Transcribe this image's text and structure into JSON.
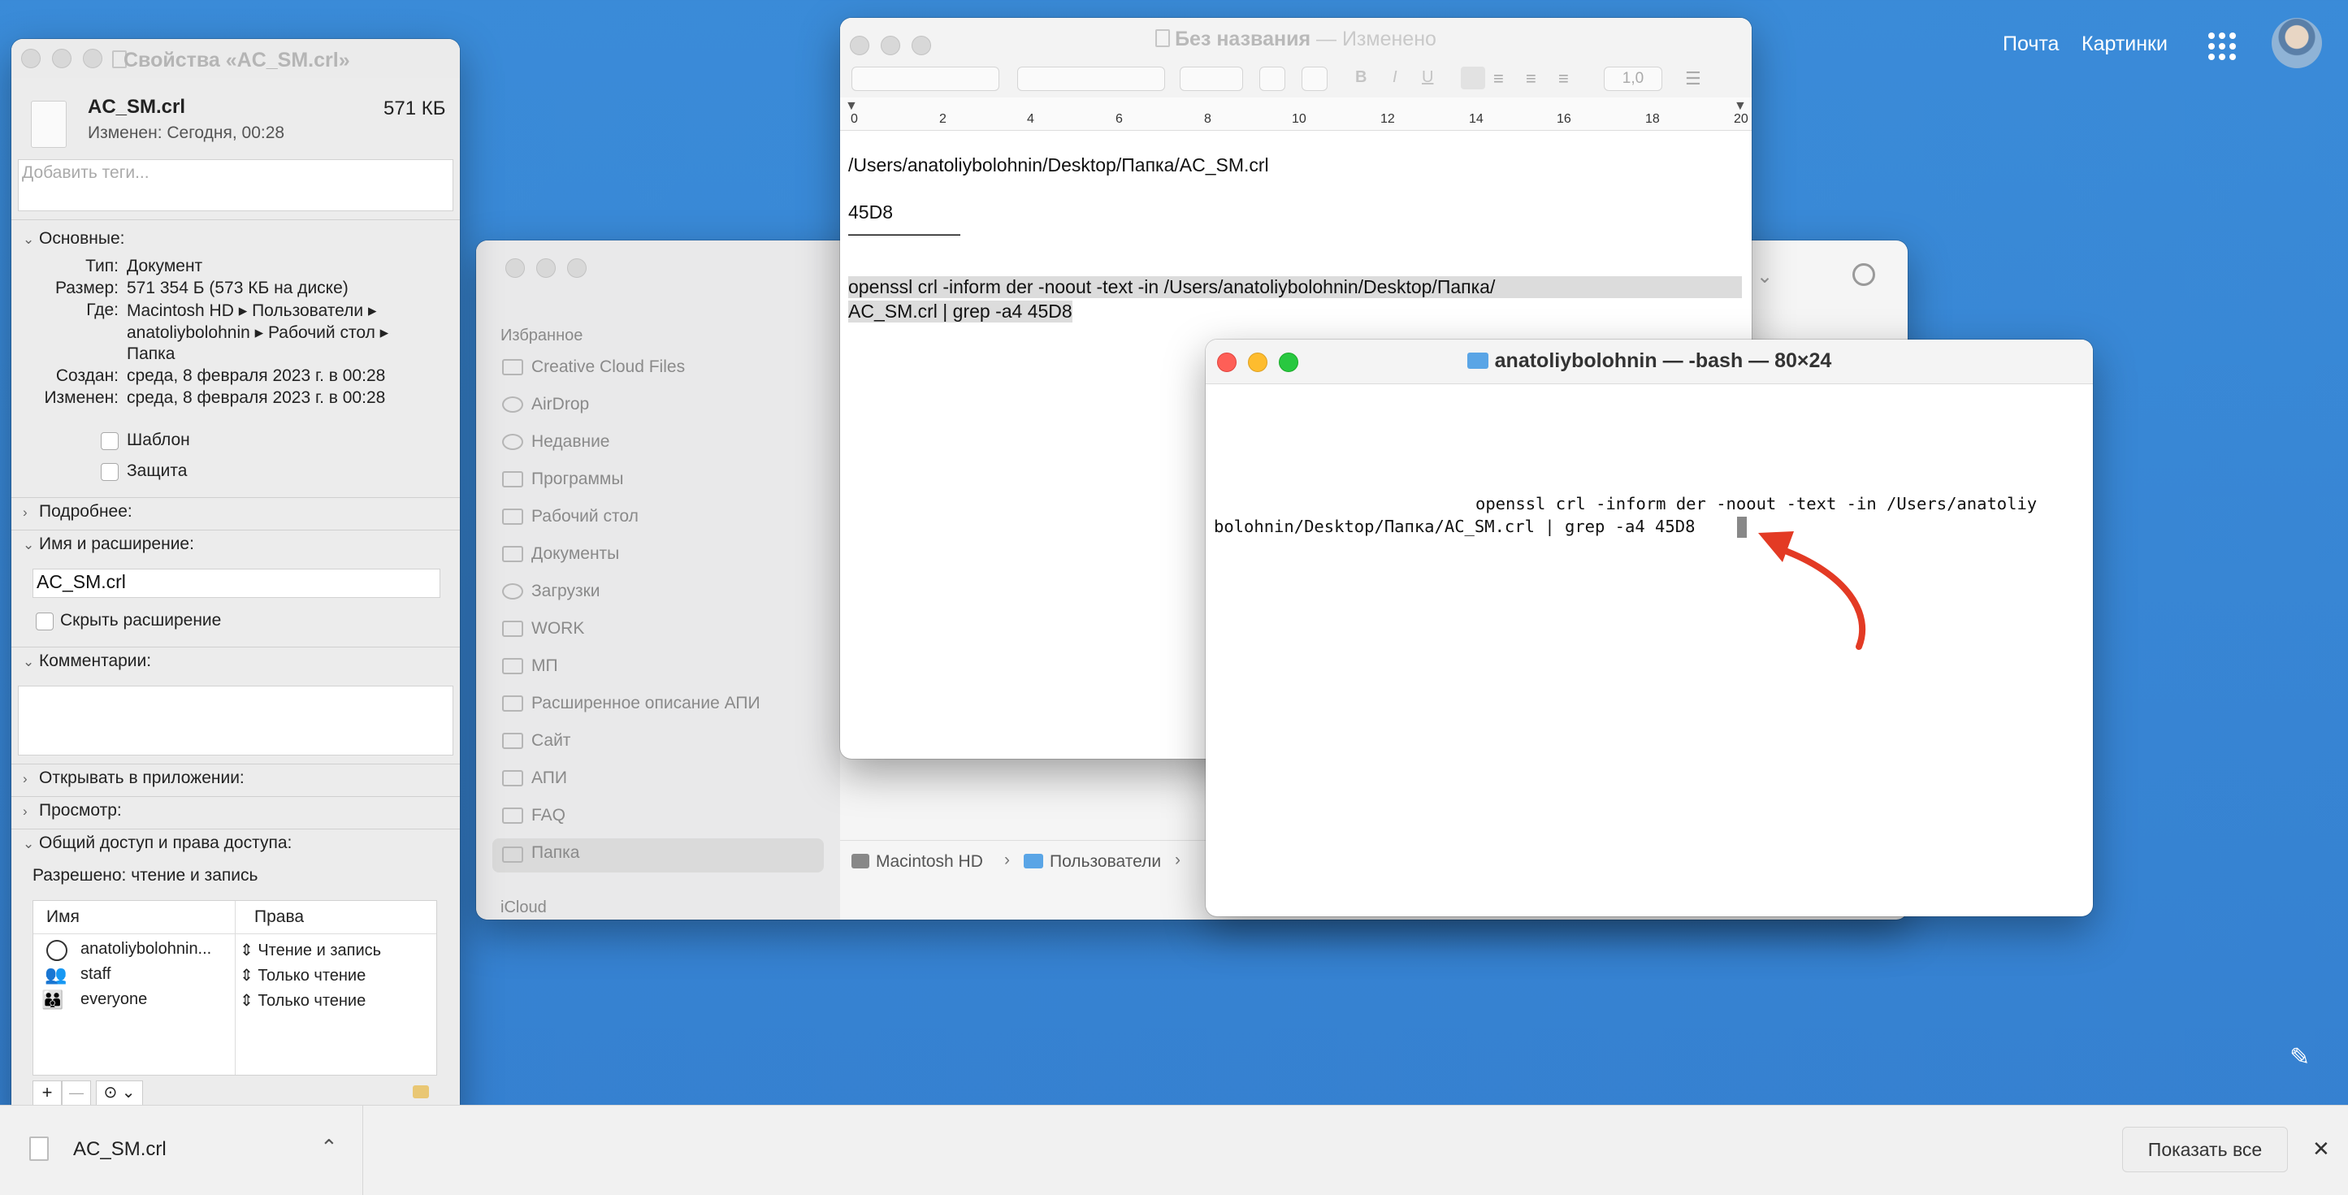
{
  "browser": {
    "mail_link": "Почта",
    "images_link": "Картинки",
    "apps_icon": "grid-icon",
    "avatar_icon": "avatar-icon",
    "edit_icon": "pencil-icon"
  },
  "info_window": {
    "title": "Свойства «AC_SM.crl»",
    "file_name": "AC_SM.crl",
    "file_size": "571 КБ",
    "modified_short": "Изменен: Сегодня, 00:28",
    "tags_placeholder": "Добавить теги...",
    "general": {
      "header": "Основные:",
      "kind_label": "Тип:",
      "kind_value": "Документ",
      "size_label": "Размер:",
      "size_value": "571 354 Б (573 КБ на диске)",
      "where_label": "Где:",
      "where_line1": "Macintosh HD ▸ Пользователи ▸",
      "where_line2": "anatoliybolohnin ▸ Рабочий стол ▸",
      "where_line3": "Папка",
      "created_label": "Создан:",
      "created_value": "среда, 8 февраля 2023 г. в 00:28",
      "modified_label": "Изменен:",
      "modified_value": "среда, 8 февраля 2023 г. в 00:28",
      "template_label": "Шаблон",
      "locked_label": "Защита"
    },
    "more_info": "Подробнее:",
    "name_ext": {
      "header": "Имя и расширение:",
      "value": "AC_SM.crl",
      "hide_ext_label": "Скрыть расширение"
    },
    "comments": "Комментарии:",
    "open_with": "Открывать в приложении:",
    "preview": "Просмотр:",
    "sharing": {
      "header": "Общий доступ и права доступа:",
      "status": "Разрешено: чтение и запись",
      "col_name": "Имя",
      "col_rights": "Права",
      "rows": [
        {
          "name": "anatoliybolohnin...",
          "rights": "Чтение и запись",
          "icon": "user-icon"
        },
        {
          "name": "staff",
          "rights": "Только чтение",
          "icon": "group-icon"
        },
        {
          "name": "everyone",
          "rights": "Только чтение",
          "icon": "everyone-icon"
        }
      ],
      "add": "+",
      "remove": "—",
      "action": "⊙",
      "lock_icon": "lock-icon"
    }
  },
  "textedit": {
    "title": "Без названия",
    "title_suffix": "— Изменено",
    "spacing": "1,0",
    "ruler": [
      "0",
      "2",
      "4",
      "6",
      "8",
      "10",
      "12",
      "14",
      "16",
      "18",
      "20"
    ],
    "lines": [
      "/Users/anatoliybolohnin/Desktop/Папка/AC_SM.crl",
      "45D8",
      "——————",
      "openssl crl -inform der -noout -text -in /Users/anatoliybolohnin/Desktop/Папка/",
      "AC_SM.crl | grep -a4 45D8"
    ]
  },
  "finder": {
    "favorites_header": "Избранное",
    "sidebar": [
      "Creative Cloud Files",
      "AirDrop",
      "Недавние",
      "Программы",
      "Рабочий стол",
      "Документы",
      "Загрузки",
      "WORK",
      "МП",
      "Расширенное описание АПИ",
      "Сайт",
      "АПИ",
      "FAQ",
      "Папка"
    ],
    "icloud_header": "iCloud",
    "path": [
      "Macintosh HD",
      "Пользователи"
    ]
  },
  "terminal": {
    "title": "anatoliybolohnin — -bash — 80×24",
    "line1": "openssl crl -inform der -noout -text -in /Users/anatoliy",
    "line2": "bolohnin/Desktop/Папка/AC_SM.crl | grep -a4 45D8"
  },
  "download_bar": {
    "file_name": "AC_SM.crl",
    "show_all": "Показать все",
    "close": "✕"
  }
}
